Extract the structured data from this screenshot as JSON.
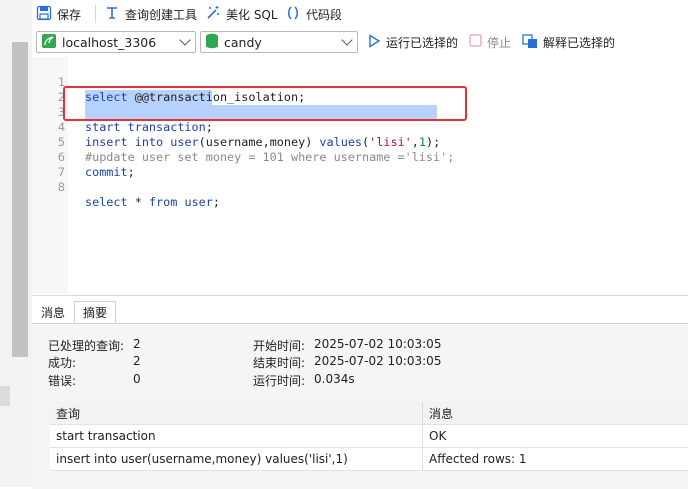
{
  "toolbar": {
    "save_label": "保存",
    "query_builder_label": "查询创建工具",
    "beautify_label": "美化 SQL",
    "snippet_label": "代码段"
  },
  "connection": {
    "selected": "localhost_3306",
    "database": "candy"
  },
  "actions": {
    "run_selected_label": "运行已选择的",
    "stop_label": "停止",
    "explain_selected_label": "解释已选择的"
  },
  "editor": {
    "lines": [
      {
        "n": "1",
        "text": "select @@transaction_isolation;"
      },
      {
        "n": "2",
        "text": ""
      },
      {
        "n": "3",
        "text": "start transaction;"
      },
      {
        "n": "4",
        "text": "insert into user(username,money) values('lisi',1);"
      },
      {
        "n": "5",
        "text": "#update user set money = 101 where username ='lisi';"
      },
      {
        "n": "6",
        "text": "commit;"
      },
      {
        "n": "7",
        "text": ""
      },
      {
        "n": "8",
        "text": "select * from user;"
      }
    ]
  },
  "result_tabs": [
    {
      "label": "消息"
    },
    {
      "label": "摘要"
    }
  ],
  "summary": {
    "processed_label": "已处理的查询:",
    "processed_value": "2",
    "success_label": "成功:",
    "success_value": "2",
    "error_label": "错误:",
    "error_value": "0",
    "start_label": "开始时间:",
    "start_value": "2025-07-02 10:03:05",
    "end_label": "结束时间:",
    "end_value": "2025-07-02 10:03:05",
    "runtime_label": "运行时间:",
    "runtime_value": "0.034s"
  },
  "results_table": {
    "columns": [
      "查询",
      "消息"
    ],
    "rows": [
      [
        "start transaction",
        "OK"
      ],
      [
        "insert into user(username,money) values('lisi',1)",
        "Affected rows: 1"
      ]
    ]
  },
  "colors": {
    "keyword": "#1a43a8",
    "string": "#b5122b",
    "number": "#0a8a3a",
    "comment": "#8a8a8a",
    "selection": "#b8d2ff",
    "annotation_box": "#e53238"
  }
}
